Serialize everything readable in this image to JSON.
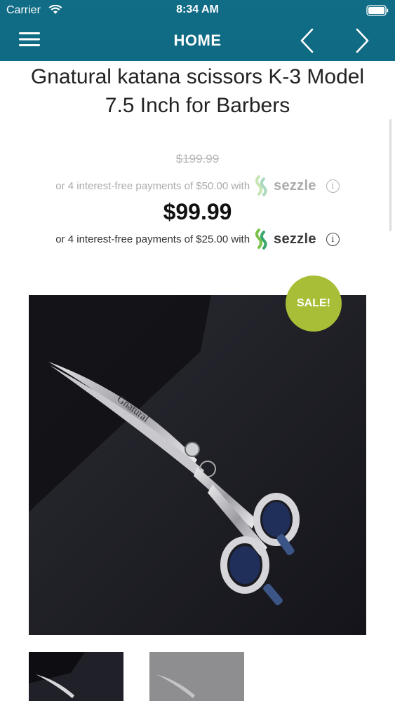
{
  "status_bar": {
    "carrier": "Carrier",
    "time": "8:34 AM"
  },
  "nav": {
    "title": "HOME",
    "menu_icon": "hamburger-menu-icon",
    "back_icon": "chevron-left-icon",
    "forward_icon": "chevron-right-icon"
  },
  "product": {
    "title": "Gnatural katana scissors K-3 Model 7.5 Inch for Barbers",
    "old_price": "$199.99",
    "price": "$99.99",
    "sezzle_old": {
      "text": "or 4 interest-free payments of $50.00 with",
      "brand": "sezzle"
    },
    "sezzle_main": {
      "text": "or 4 interest-free payments of $25.00 with",
      "brand": "sezzle"
    },
    "info_glyph": "i",
    "sale_badge": "SALE!",
    "image_text": "Gnatural"
  },
  "colors": {
    "header": "#116c86",
    "sale_badge": "#a8be37",
    "sezzle_green": "#7cc24a"
  }
}
